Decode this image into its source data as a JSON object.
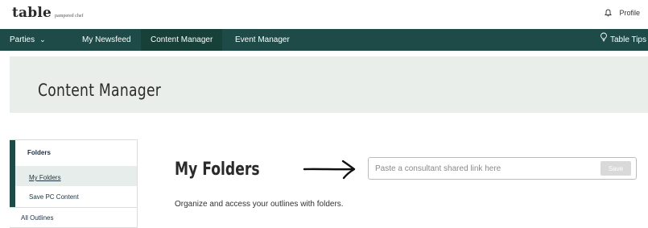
{
  "header": {
    "logo_main": "table",
    "logo_sub": "pampered chef",
    "profile_label": "Profile"
  },
  "nav": {
    "items": [
      {
        "label": "Parties",
        "has_dropdown": true
      },
      {
        "label": "My Newsfeed"
      },
      {
        "label": "Content Manager",
        "active": true
      },
      {
        "label": "Event Manager"
      }
    ],
    "tips_label": "Table Tips"
  },
  "hero": {
    "title": "Content Manager"
  },
  "sidebar": {
    "header": "Folders",
    "items": [
      {
        "label": "My Folders",
        "active": true
      },
      {
        "label": "Save PC Content"
      }
    ],
    "all_outlines": "All Outlines"
  },
  "main": {
    "title": "My Folders",
    "link_placeholder": "Paste a consultant shared link here",
    "save_label": "Save",
    "description": "Organize and access your outlines with folders."
  },
  "colors": {
    "nav_bg": "#1e4a48",
    "nav_active_bg": "#174039",
    "hero_bg": "#eaeeeb",
    "sidebar_active_bg": "#e7edea",
    "save_button_bg": "#d9d9d9"
  },
  "icons": {
    "notification": "bell-icon",
    "tips": "lightbulb-icon",
    "dropdown": "chevron-down-icon",
    "annotation": "arrow-right-icon"
  }
}
